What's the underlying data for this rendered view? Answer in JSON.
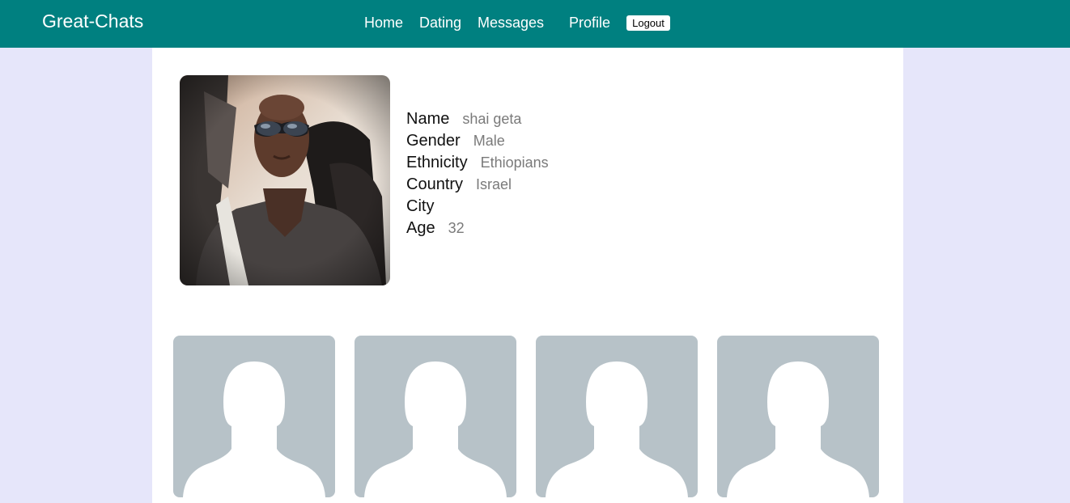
{
  "header": {
    "brand": "Great-Chats",
    "nav": {
      "home": "Home",
      "dating": "Dating",
      "messages": "Messages",
      "profile": "Profile",
      "logout": "Logout"
    }
  },
  "profile": {
    "photo_icon": "user-photo",
    "fields": [
      {
        "label": "Name",
        "value": "shai geta"
      },
      {
        "label": "Gender",
        "value": "Male"
      },
      {
        "label": "Ethnicity",
        "value": "Ethiopians"
      },
      {
        "label": "Country",
        "value": "Israel"
      },
      {
        "label": "City",
        "value": ""
      },
      {
        "label": "Age",
        "value": "32"
      }
    ]
  },
  "members": [
    {
      "icon": "default-avatar-silhouette"
    },
    {
      "icon": "default-avatar-silhouette"
    },
    {
      "icon": "default-avatar-silhouette"
    },
    {
      "icon": "default-avatar-silhouette"
    }
  ],
  "colors": {
    "header": "#008080",
    "page_background": "#e6e6fa",
    "panel": "#ffffff",
    "avatar_background": "#b7c2c8",
    "value_text": "#7a7a7a"
  }
}
